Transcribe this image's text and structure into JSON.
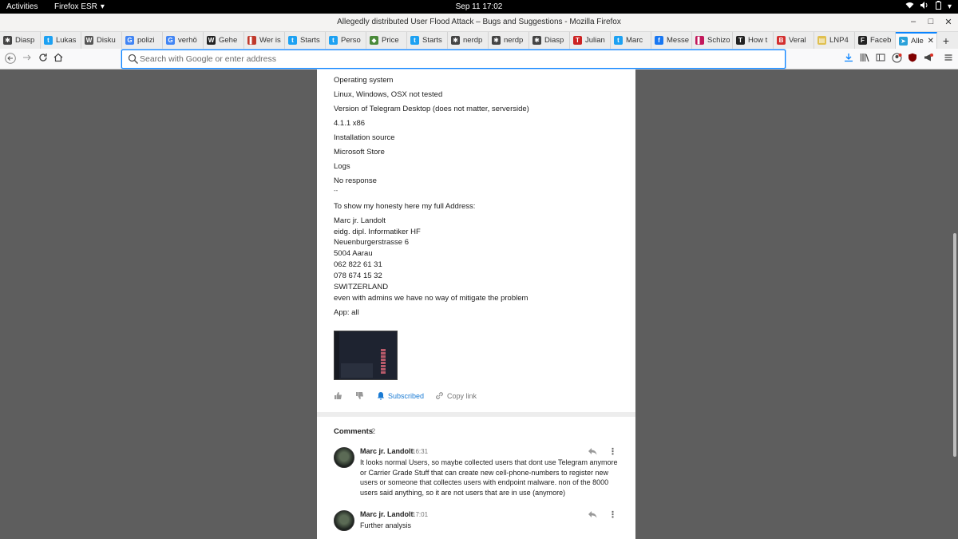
{
  "topbar": {
    "activities": "Activities",
    "app_menu": "Firefox ESR",
    "clock": "Sep 11  17:02"
  },
  "window": {
    "title": "Allegedly distributed User Flood Attack – Bugs and Suggestions - Mozilla Firefox"
  },
  "tabs": [
    {
      "label": "Diasp",
      "icon": "diaspora-icon",
      "color": "#444444"
    },
    {
      "label": "Lukas",
      "icon": "twitter-icon",
      "color": "#1da1f2"
    },
    {
      "label": "Disku",
      "icon": "wikipedia-icon",
      "color": "#555555"
    },
    {
      "label": "polizi",
      "icon": "google-icon",
      "color": "#4285f4"
    },
    {
      "label": "verhö",
      "icon": "google-icon",
      "color": "#4285f4"
    },
    {
      "label": "Gehe",
      "icon": "w-icon",
      "color": "#222222"
    },
    {
      "label": "Wer is",
      "icon": "bookmark-icon",
      "color": "#c0392b"
    },
    {
      "label": "Starts",
      "icon": "twitter-icon",
      "color": "#1da1f2"
    },
    {
      "label": "Perso",
      "icon": "twitter-icon",
      "color": "#1da1f2"
    },
    {
      "label": "Price",
      "icon": "shield-icon",
      "color": "#4a8a3a"
    },
    {
      "label": "Starts",
      "icon": "twitter-icon",
      "color": "#1da1f2"
    },
    {
      "label": "nerdp",
      "icon": "diaspora-icon",
      "color": "#444444"
    },
    {
      "label": "nerdp",
      "icon": "diaspora-icon",
      "color": "#444444"
    },
    {
      "label": "Diasp",
      "icon": "diaspora-icon",
      "color": "#444444"
    },
    {
      "label": "Julian",
      "icon": "t-icon",
      "color": "#cc2222"
    },
    {
      "label": "Marc",
      "icon": "twitter-icon",
      "color": "#1da1f2"
    },
    {
      "label": "Messe",
      "icon": "facebook-icon",
      "color": "#1877f2"
    },
    {
      "label": "Schizo",
      "icon": "bookmark-icon",
      "color": "#c2185b"
    },
    {
      "label": "How t",
      "icon": "nyt-icon",
      "color": "#222222"
    },
    {
      "label": "Veral",
      "icon": "b-icon",
      "color": "#d32f2f"
    },
    {
      "label": "LNP4",
      "icon": "podcast-icon",
      "color": "#e0c050"
    },
    {
      "label": "Faceb",
      "icon": "f-icon",
      "color": "#222222"
    },
    {
      "label": "Alle",
      "icon": "telegram-icon",
      "color": "#2aa1da",
      "active": true
    }
  ],
  "navbar": {
    "url_placeholder": "Search with Google or enter address"
  },
  "post": {
    "lines": [
      "Operating system",
      "Linux, Windows, OSX not tested",
      "Version of Telegram Desktop (does not matter, serverside)",
      "4.1.1 x86",
      "Installation source",
      "Microsoft Store",
      "Logs",
      "No response",
      "--",
      "To show my honesty here my full Address:"
    ],
    "address": [
      "Marc jr. Landolt",
      "eidg. dipl. Informatiker HF",
      "Neuenburgerstrasse 6",
      "5004 Aarau",
      "062 822 61 31",
      "078 674 15 32",
      "SWITZERLAND",
      "even with admins we have no way of mitigate the problem"
    ],
    "app_line": "App: all",
    "actions": {
      "subscribed": "Subscribed",
      "copy_link": "Copy link"
    }
  },
  "comments": {
    "title": "Comments",
    "count": "2",
    "items": [
      {
        "author": "Marc jr. Landolt",
        "time": "16:31",
        "text": "It looks normal Users, so maybe collected users that dont use Telegram anymore or Carrier Grade Stuff that can create new cell-phone-numbers to register new users or someone that collectes users with endpoint malware. non of the 8000 users said anything, so it are not users that are in use (anymore)"
      },
      {
        "author": "Marc jr. Landolt",
        "time": "17:01",
        "text": "Further analysis"
      }
    ]
  },
  "colors": {
    "accent": "#0a84ff",
    "subscribed": "#1a7bd4",
    "background": "#5e5e5e"
  }
}
